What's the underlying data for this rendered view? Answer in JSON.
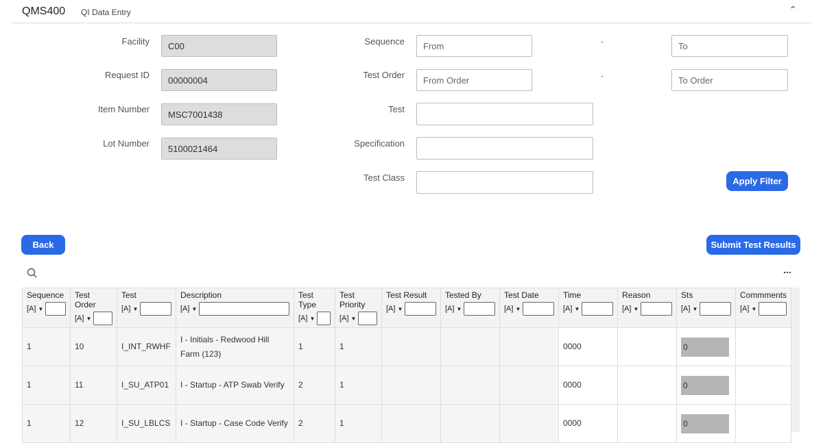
{
  "header": {
    "app": "QMS400",
    "subtitle": "QI Data Entry"
  },
  "form": {
    "facility": {
      "label": "Facility",
      "value": "C00"
    },
    "request_id": {
      "label": "Request ID",
      "value": "00000004"
    },
    "item_number": {
      "label": "Item Number",
      "value": "MSC7001438"
    },
    "lot_number": {
      "label": "Lot Number",
      "value": "5100021464"
    },
    "sequence": {
      "label": "Sequence",
      "from": "From",
      "to": "To"
    },
    "test_order": {
      "label": "Test Order",
      "from": "From Order",
      "to": "To Order"
    },
    "test": {
      "label": "Test",
      "value": ""
    },
    "specification": {
      "label": "Specification",
      "value": ""
    },
    "test_class": {
      "label": "Test Class",
      "value": ""
    },
    "dash": "-"
  },
  "buttons": {
    "apply": "Apply Filter",
    "back": "Back",
    "submit": "Submit Test Results",
    "more": "..."
  },
  "table": {
    "filter_label": "[A]",
    "columns": [
      "Sequence",
      "Test Order",
      "Test",
      "Description",
      "Test Type",
      "Test Priority",
      "Test Result",
      "Tested By",
      "Test Date",
      "Time",
      "Reason",
      "Sts",
      "Commments"
    ],
    "rows": [
      [
        "1",
        "10",
        "I_INT_RWHF",
        "I - Initials - Redwood Hill Farm (123)",
        "1",
        "1",
        "",
        "",
        "",
        "0000",
        "",
        "0",
        ""
      ],
      [
        "1",
        "11",
        "I_SU_ATP01",
        "I - Startup - ATP Swab Verify",
        "2",
        "1",
        "",
        "",
        "",
        "0000",
        "",
        "0",
        ""
      ],
      [
        "1",
        "12",
        "I_SU_LBLCS",
        "I - Startup - Case Code Verify",
        "2",
        "1",
        "",
        "",
        "",
        "0000",
        "",
        "0",
        ""
      ]
    ]
  }
}
